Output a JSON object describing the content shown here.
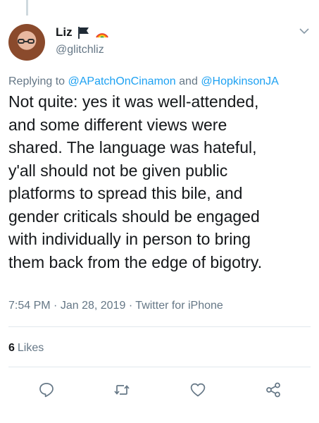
{
  "author": {
    "display_name": "Liz",
    "handle": "@glitchliz",
    "avatar_icon": "avatar",
    "badges": [
      "black-flag-icon",
      "rainbow-icon"
    ]
  },
  "reply": {
    "prefix": "Replying to",
    "mention_1": "@APatchOnCinamon",
    "joiner": "and",
    "mention_2": "@HopkinsonJA"
  },
  "tweet": {
    "text": "Not quite: yes it was well-attended,\nand some different views were\nshared. The language was hateful,\ny'all should not be given public\nplatforms to spread this bile, and\ngender criticals should be engaged\nwith individually in person to bring\nthem back from the edge of bigotry."
  },
  "meta": {
    "time": "7:54 PM",
    "date": "Jan 28, 2019",
    "source": "Twitter for iPhone",
    "sep": "·"
  },
  "stats": {
    "likes_count": "6",
    "likes_label": "Likes"
  },
  "actions": [
    "reply-icon",
    "retweet-icon",
    "like-icon",
    "share-icon"
  ],
  "colors": {
    "accent": "#1da1f2",
    "muted": "#657786",
    "text": "#14171a",
    "divider": "#e1e8ed"
  }
}
